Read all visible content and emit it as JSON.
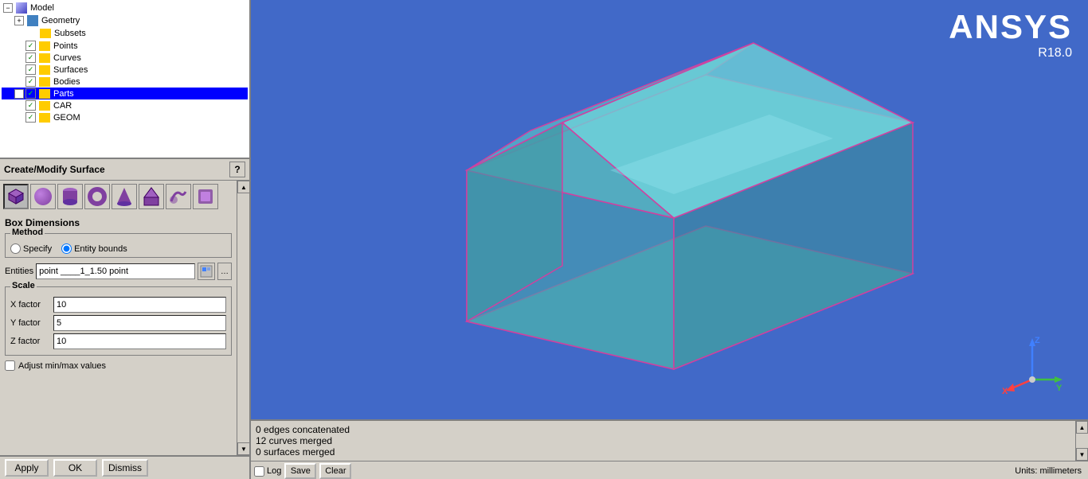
{
  "tree": {
    "items": [
      {
        "label": "Model",
        "level": 0,
        "expand": "-",
        "hasCheck": false,
        "selected": false,
        "iconType": "model"
      },
      {
        "label": "Geometry",
        "level": 1,
        "expand": "+",
        "hasCheck": false,
        "selected": false,
        "iconType": "geo"
      },
      {
        "label": "Subsets",
        "level": 2,
        "expand": null,
        "hasCheck": false,
        "selected": false,
        "iconType": "folder"
      },
      {
        "label": "Points",
        "level": 2,
        "expand": null,
        "hasCheck": true,
        "selected": false,
        "iconType": "folder"
      },
      {
        "label": "Curves",
        "level": 2,
        "expand": null,
        "hasCheck": true,
        "selected": false,
        "iconType": "folder"
      },
      {
        "label": "Surfaces",
        "level": 2,
        "expand": null,
        "hasCheck": true,
        "selected": false,
        "iconType": "folder"
      },
      {
        "label": "Bodies",
        "level": 2,
        "expand": null,
        "hasCheck": true,
        "selected": false,
        "iconType": "folder"
      },
      {
        "label": "Parts",
        "level": 1,
        "expand": "-",
        "hasCheck": true,
        "selected": true,
        "iconType": "folder"
      },
      {
        "label": "CAR",
        "level": 2,
        "expand": null,
        "hasCheck": true,
        "selected": false,
        "iconType": "folder"
      },
      {
        "label": "GEOM",
        "level": 2,
        "expand": null,
        "hasCheck": true,
        "selected": false,
        "iconType": "folder"
      }
    ]
  },
  "panel": {
    "title": "Create/Modify Surface",
    "help_label": "?",
    "box_dimensions_label": "Box Dimensions",
    "method_label": "Method",
    "specify_label": "Specify",
    "entity_bounds_label": "Entity bounds",
    "entities_label": "Entities",
    "entities_value": "point ____1_1.50 point",
    "scale_label": "Scale",
    "x_factor_label": "X factor",
    "x_factor_value": "10",
    "y_factor_label": "Y factor",
    "y_factor_value": "5",
    "z_factor_label": "Z factor",
    "z_factor_value": "10",
    "adjust_minmax_label": "Adjust min/max values",
    "apply_label": "Apply",
    "ok_label": "OK",
    "dismiss_label": "Dismiss"
  },
  "ansys": {
    "brand": "ANSYS",
    "version": "R18.0"
  },
  "console": {
    "lines": [
      "0 edges concatenated",
      "12 curves merged",
      "0 surfaces merged"
    ],
    "log_label": "Log",
    "save_label": "Save",
    "clear_label": "Clear",
    "units_label": "Units: millimeters"
  },
  "icons": {
    "gear": "⚙",
    "expand_minus": "−",
    "expand_plus": "+",
    "check": "✓",
    "scroll_up": "▲",
    "scroll_down": "▼",
    "chevron_up": "▲",
    "chevron_down": "▼"
  }
}
